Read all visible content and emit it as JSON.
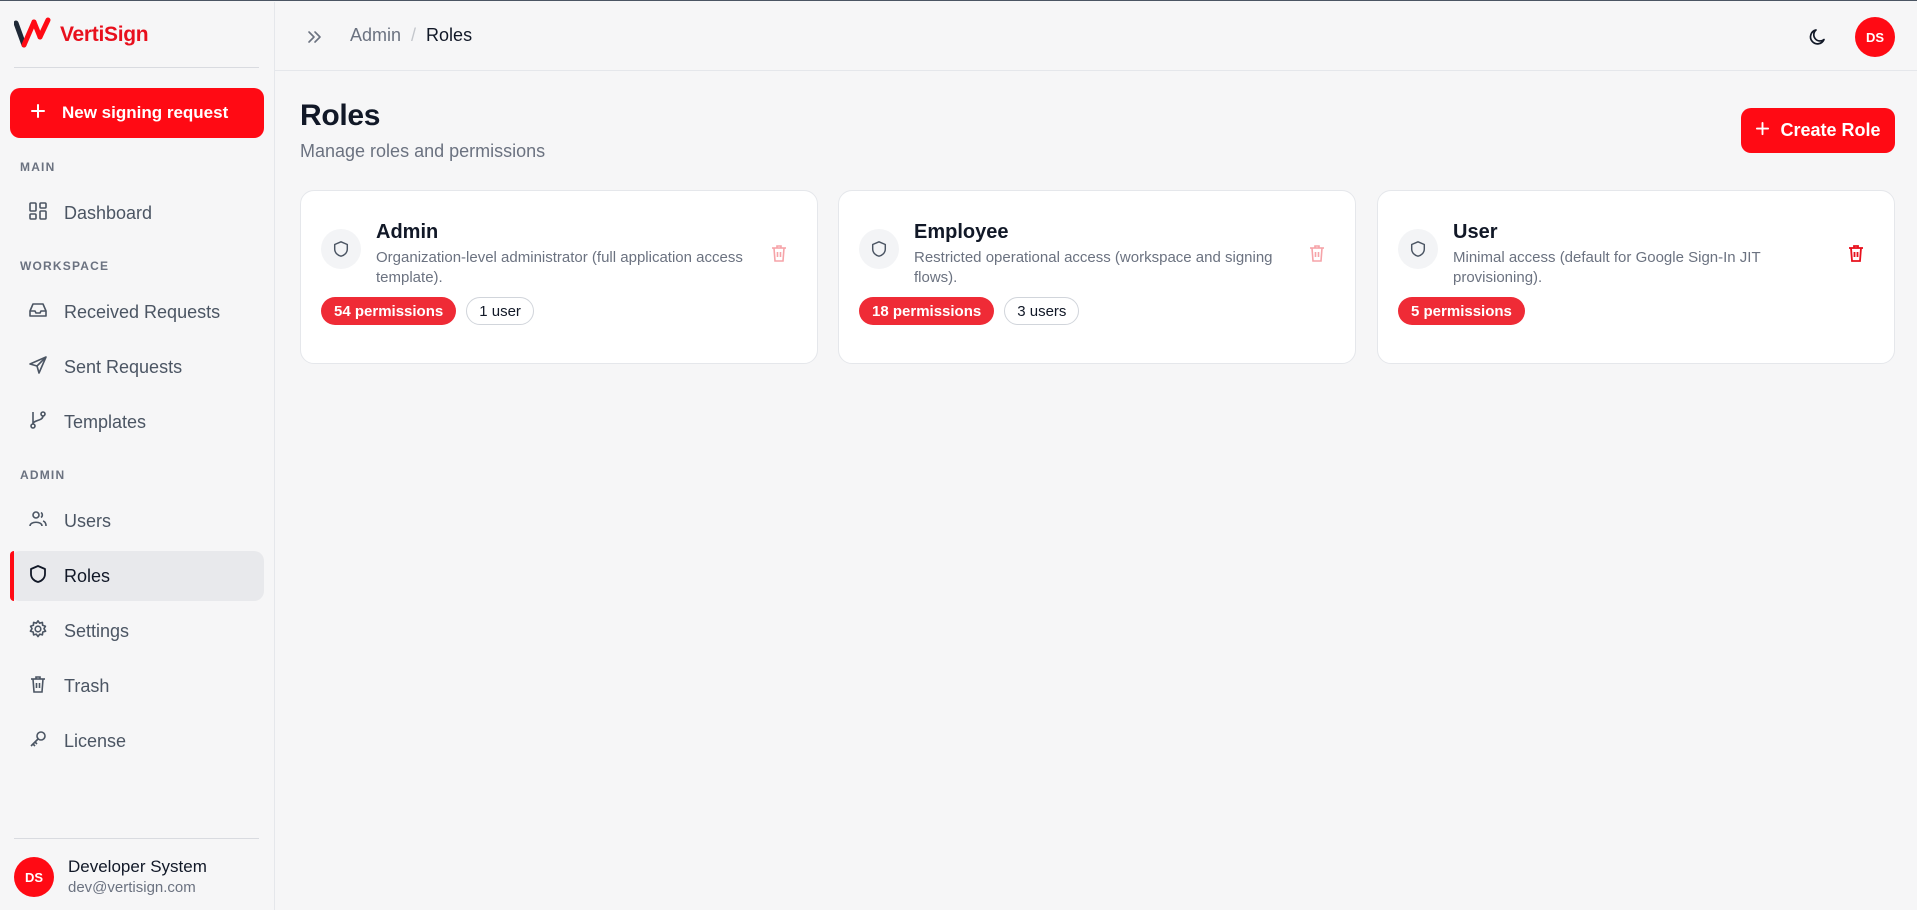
{
  "brand": {
    "name": "VertiSign",
    "color": "#e8101d"
  },
  "sidebar": {
    "new_request_label": "New signing request",
    "sections": {
      "main": "MAIN",
      "workspace": "WORKSPACE",
      "admin": "ADMIN"
    },
    "items": {
      "dashboard": "Dashboard",
      "received": "Received Requests",
      "sent": "Sent Requests",
      "templates": "Templates",
      "users": "Users",
      "roles": "Roles",
      "settings": "Settings",
      "trash": "Trash",
      "license": "License"
    },
    "active_item": "Roles",
    "user": {
      "initials": "DS",
      "name": "Developer System",
      "email": "dev@vertisign.com"
    }
  },
  "topbar": {
    "breadcrumb_parent": "Admin",
    "breadcrumb_separator": "/",
    "breadcrumb_current": "Roles",
    "avatar_initials": "DS"
  },
  "page": {
    "title": "Roles",
    "subtitle": "Manage roles and permissions",
    "create_label": "Create Role"
  },
  "roles": [
    {
      "name": "Admin",
      "description": "Organization-level administrator (full application access template).",
      "permissions": "54 permissions",
      "users": "1 user",
      "delete_enabled": false
    },
    {
      "name": "Employee",
      "description": "Restricted operational access (workspace and signing flows).",
      "permissions": "18 permissions",
      "users": "3 users",
      "delete_enabled": false
    },
    {
      "name": "User",
      "description": "Minimal access (default for Google Sign-In JIT provisioning).",
      "permissions": "5 permissions",
      "delete_enabled": true
    }
  ],
  "colors": {
    "accent": "#ff0a14",
    "badge": "#ef2b36",
    "trash_disabled": "#f6a3a8",
    "trash_enabled": "#e8101d"
  }
}
